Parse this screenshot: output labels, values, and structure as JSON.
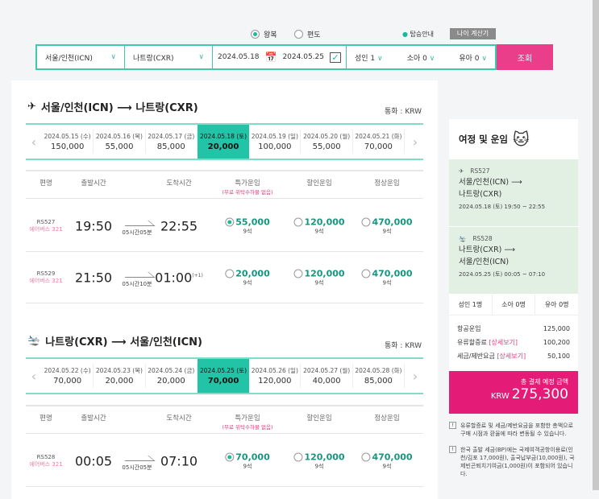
{
  "trip_type": {
    "round": "왕복",
    "oneway": "편도"
  },
  "top_links": {
    "boarding_info": "탑승안내",
    "age_calc": "나이 계산기"
  },
  "search": {
    "origin": "서울/인천(ICN)",
    "destination": "나트랑(CXR)",
    "depart_date": "2024.05.18",
    "return_date": "2024.05.25",
    "adult": "성인 1",
    "child": "소아 0",
    "infant": "유아 0",
    "submit": "조회"
  },
  "outbound": {
    "title": "서울/인천(ICN) ⟶ 나트랑(CXR)",
    "currency": "통화 : KRW",
    "dates": [
      {
        "d": "2024.05.15 (수)",
        "p": "150,000"
      },
      {
        "d": "2024.05.16 (목)",
        "p": "55,000"
      },
      {
        "d": "2024.05.17 (금)",
        "p": "85,000"
      },
      {
        "d": "2024.05.18 (토)",
        "p": "20,000"
      },
      {
        "d": "2024.05.19 (일)",
        "p": "100,000"
      },
      {
        "d": "2024.05.20 (월)",
        "p": "55,000"
      },
      {
        "d": "2024.05.21 (화)",
        "p": "70,000"
      }
    ],
    "flights": [
      {
        "no": "RS527",
        "ac": "에어버스 321",
        "dep": "19:50",
        "dur": "05시간05분",
        "arr": "22:55",
        "plus": "",
        "special": "55,000",
        "discount": "120,000",
        "normal": "470,000",
        "seats": "9석"
      },
      {
        "no": "RS529",
        "ac": "에어버스 321",
        "dep": "21:50",
        "dur": "05시간10분",
        "arr": "01:00",
        "plus": "(+1)",
        "special": "20,000",
        "discount": "120,000",
        "normal": "470,000",
        "seats": "9석"
      }
    ]
  },
  "inbound": {
    "title": "나트랑(CXR) ⟶ 서울/인천(ICN)",
    "currency": "통화 : KRW",
    "dates": [
      {
        "d": "2024.05.22 (수)",
        "p": "70,000"
      },
      {
        "d": "2024.05.23 (목)",
        "p": "20,000"
      },
      {
        "d": "2024.05.24 (금)",
        "p": "20,000"
      },
      {
        "d": "2024.05.25 (토)",
        "p": "70,000"
      },
      {
        "d": "2024.05.26 (일)",
        "p": "120,000"
      },
      {
        "d": "2024.05.27 (월)",
        "p": "40,000"
      },
      {
        "d": "2024.05.28 (화)",
        "p": "85,000"
      }
    ],
    "flights": [
      {
        "no": "RS528",
        "ac": "에어버스 321",
        "dep": "00:05",
        "dur": "05시간05분",
        "arr": "07:10",
        "plus": "",
        "special": "70,000",
        "discount": "120,000",
        "normal": "470,000",
        "seats": "9석"
      }
    ]
  },
  "columns": {
    "flight": "편명",
    "dep": "출발시간",
    "arr": "도착시간",
    "special": "특가운임",
    "special_note": "(무료 위탁수하물 없음)",
    "discount": "할인운임",
    "normal": "정상운임"
  },
  "summary": {
    "title": "여정 및 운임",
    "legs": [
      {
        "no": "RS527",
        "from": "서울/인천(ICN) ⟶",
        "to": "나트랑(CXR)",
        "when": "2024.05.18 (토) 19:50 ~ 22:55"
      },
      {
        "no": "RS528",
        "from": "나트랑(CXR) ⟶",
        "to": "서울/인천(ICN)",
        "when": "2024.05.25 (토) 00:05 ~ 07:10"
      }
    ],
    "pax": [
      "성인 1명",
      "소아 0명",
      "유아 0명"
    ],
    "fares": [
      {
        "label": "항공운임",
        "link": "",
        "value": "125,000"
      },
      {
        "label": "유류할증료",
        "link": "[상세보기]",
        "value": "100,200"
      },
      {
        "label": "세금/제반요금",
        "link": "[상세보기]",
        "value": "50,100"
      }
    ],
    "total_label": "총 결제 예정 금액",
    "total_currency": "KRW",
    "total": "275,300",
    "notes": [
      "유류할증료 및 세금/제반요금을 포함한 총액으로 구매 시점과 환율에 따라 변동될 수 있습니다.",
      "한국 출발 세금(BP)에는 국제여객공항이용료(인천/김포 17,000원), 출국납부금(10,000원), 국제빈곤퇴치기여금(1,000원)이 포함되어 있습니다."
    ]
  },
  "colors": {
    "accent": "#22c3a6",
    "pink": "#e41c77",
    "green_bg": "#e1f0e3"
  }
}
